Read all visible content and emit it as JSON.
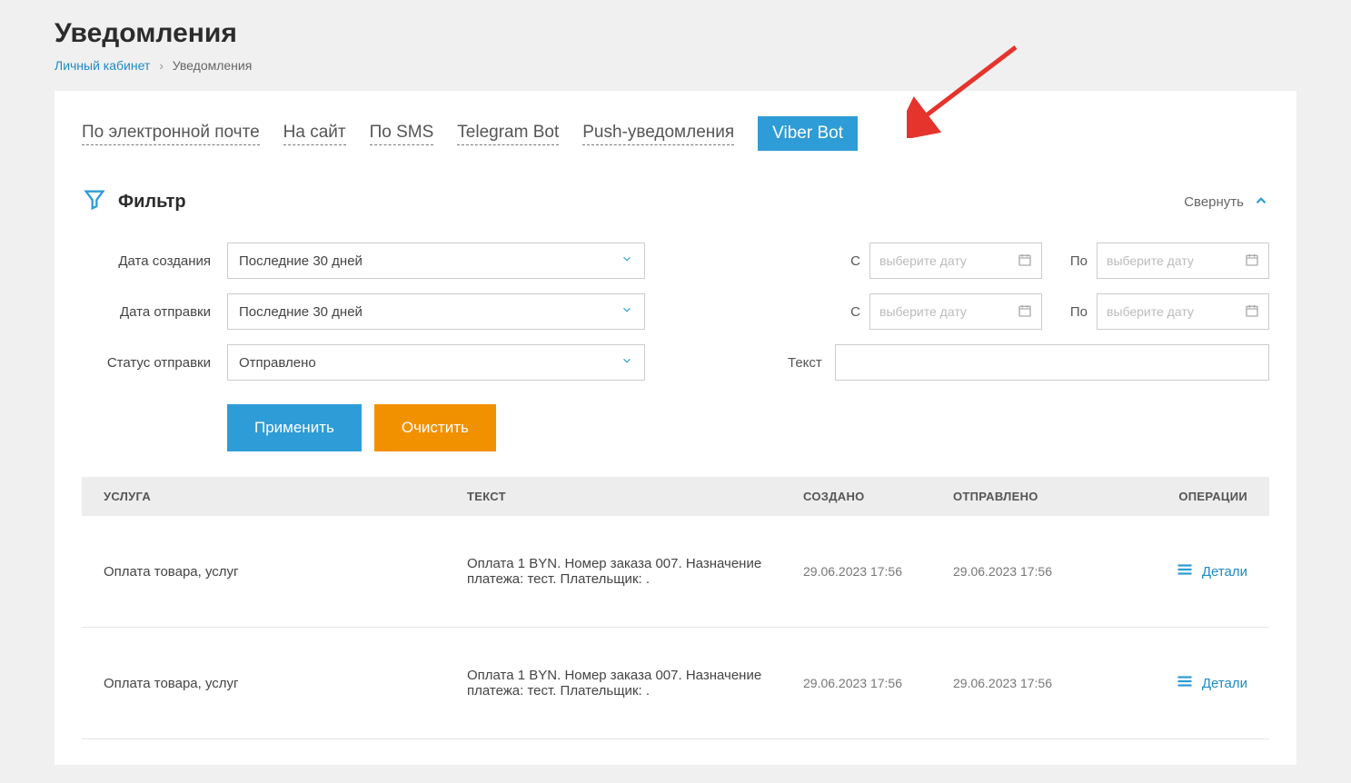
{
  "page": {
    "title": "Уведомления"
  },
  "breadcrumb": {
    "home": "Личный кабинет",
    "current": "Уведомления"
  },
  "tabs": {
    "email": "По электронной почте",
    "site": "На сайт",
    "sms": "По SMS",
    "telegram": "Telegram Bot",
    "push": "Push-уведомления",
    "viber": "Viber Bot"
  },
  "filter": {
    "title": "Фильтр",
    "collapse": "Свернуть",
    "labels": {
      "date_created": "Дата создания",
      "date_sent": "Дата отправки",
      "status": "Статус отправки",
      "from": "С",
      "to": "По",
      "text": "Текст"
    },
    "values": {
      "date_created_range": "Последние 30 дней",
      "date_sent_range": "Последние 30 дней",
      "status": "Отправлено",
      "date_placeholder": "выберите дату",
      "text_value": ""
    },
    "buttons": {
      "apply": "Применить",
      "clear": "Очистить"
    }
  },
  "table": {
    "headers": {
      "service": "УСЛУГА",
      "text": "ТЕКСТ",
      "created": "СОЗДАНО",
      "sent": "ОТПРАВЛЕНО",
      "ops": "ОПЕРАЦИИ"
    },
    "rows": [
      {
        "service": "Оплата товара, услуг",
        "text": "Оплата 1 BYN. Номер заказа 007. Назначение платежа: тест. Плательщик: .",
        "created": "29.06.2023 17:56",
        "sent": "29.06.2023 17:56"
      },
      {
        "service": "Оплата товара, услуг",
        "text": "Оплата 1 BYN. Номер заказа 007. Назначение платежа: тест. Плательщик: .",
        "created": "29.06.2023 17:56",
        "sent": "29.06.2023 17:56"
      }
    ],
    "details_label": "Детали"
  }
}
